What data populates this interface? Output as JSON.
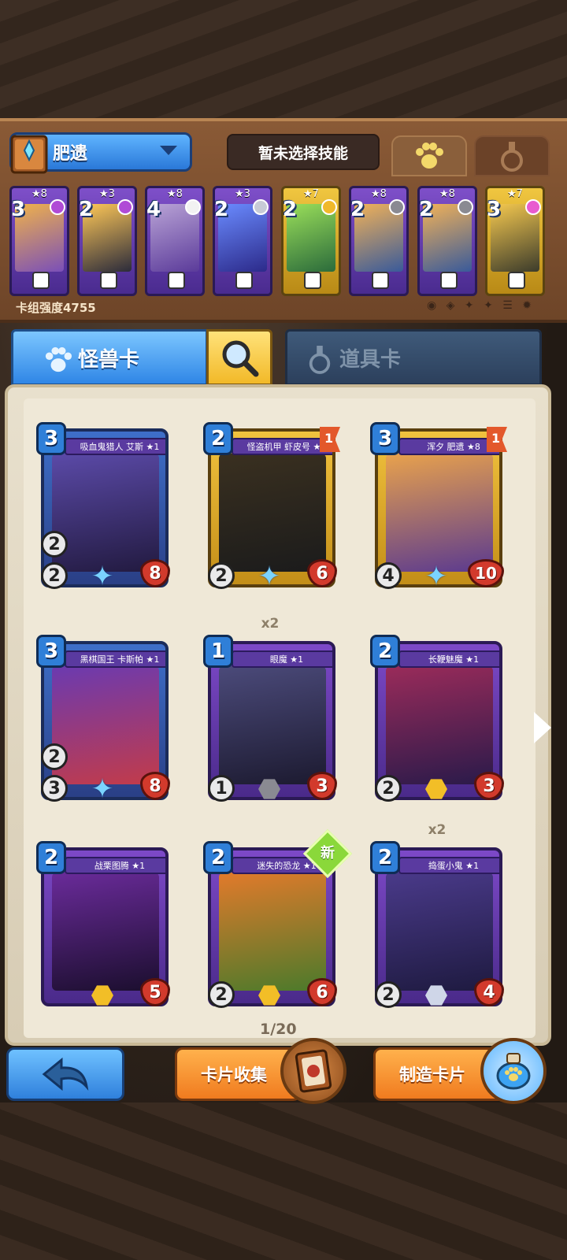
{
  "deck": {
    "name": "肥遗",
    "skill_text": "暂未选择技能",
    "strength_text": "卡组强度4755",
    "cards": [
      {
        "cost": "3",
        "stars": "★8",
        "color": "purple",
        "gem": "#b04bd6"
      },
      {
        "cost": "2",
        "stars": "★3",
        "color": "purple",
        "gem": "#b04bd6"
      },
      {
        "cost": "4",
        "stars": "★8",
        "color": "purple",
        "gem": "#f2f2f2"
      },
      {
        "cost": "2",
        "stars": "★3",
        "color": "purple",
        "gem": "#c7cbd6"
      },
      {
        "cost": "2",
        "stars": "★7",
        "color": "gold",
        "gem": "#f0b92a"
      },
      {
        "cost": "2",
        "stars": "★8",
        "color": "purple",
        "gem": "#8a8a92"
      },
      {
        "cost": "2",
        "stars": "★8",
        "color": "purple",
        "gem": "#8a8a92"
      },
      {
        "cost": "3",
        "stars": "★7",
        "color": "gold",
        "gem": "#e85bd0"
      }
    ]
  },
  "tabs": {
    "monster_label": "怪兽卡",
    "item_label": "道具卡"
  },
  "collection": {
    "page_indicator": "1/20",
    "cards": [
      {
        "name": "吸血鬼猎人 艾斯 ★1",
        "cost": "3",
        "atk": "2",
        "spd": "2",
        "hp": "8",
        "frame": "blue",
        "bottom": "star",
        "badge": "",
        "x2": ""
      },
      {
        "name": "怪盗机甲 虾皮号 ★3",
        "cost": "2",
        "atk": "",
        "spd": "2",
        "hp": "6",
        "frame": "gold",
        "bottom": "star",
        "badge": "1",
        "x2": ""
      },
      {
        "name": "浑夕 肥遗 ★8",
        "cost": "3",
        "atk": "",
        "spd": "4",
        "hp": "10",
        "frame": "gold",
        "bottom": "star",
        "badge": "1",
        "x2": ""
      },
      {
        "name": "黑棋国王 卡斯帕 ★1",
        "cost": "3",
        "atk": "2",
        "spd": "3",
        "hp": "8",
        "frame": "blue",
        "bottom": "star",
        "badge": "",
        "x2": ""
      },
      {
        "name": "眼魔 ★1",
        "cost": "1",
        "atk": "",
        "spd": "1",
        "hp": "3",
        "frame": "purple",
        "bottom": "gray",
        "badge": "",
        "x2": "x2"
      },
      {
        "name": "长鞭魅魔 ★1",
        "cost": "2",
        "atk": "",
        "spd": "2",
        "hp": "3",
        "frame": "purple",
        "bottom": "gold",
        "badge": "",
        "x2": ""
      },
      {
        "name": "战栗图腾 ★1",
        "cost": "2",
        "atk": "",
        "spd": "",
        "hp": "5",
        "frame": "purple",
        "bottom": "gold",
        "badge": "",
        "x2": ""
      },
      {
        "name": "迷失的恐龙 ★1",
        "cost": "2",
        "atk": "",
        "spd": "2",
        "hp": "6",
        "frame": "purple",
        "bottom": "gold",
        "badge": "",
        "x2": "",
        "new": "新"
      },
      {
        "name": "捣蛋小鬼 ★1",
        "cost": "2",
        "atk": "",
        "spd": "2",
        "hp": "4",
        "frame": "purple",
        "bottom": "silver",
        "badge": "",
        "x2": "x2"
      }
    ]
  },
  "buttons": {
    "collect_label": "卡片收集",
    "craft_label": "制造卡片"
  },
  "icons": {
    "back": "back-arrow-icon",
    "search": "magnifier-icon",
    "paw": "paw-icon",
    "flask": "flask-icon",
    "next": "chevron-right-icon"
  }
}
